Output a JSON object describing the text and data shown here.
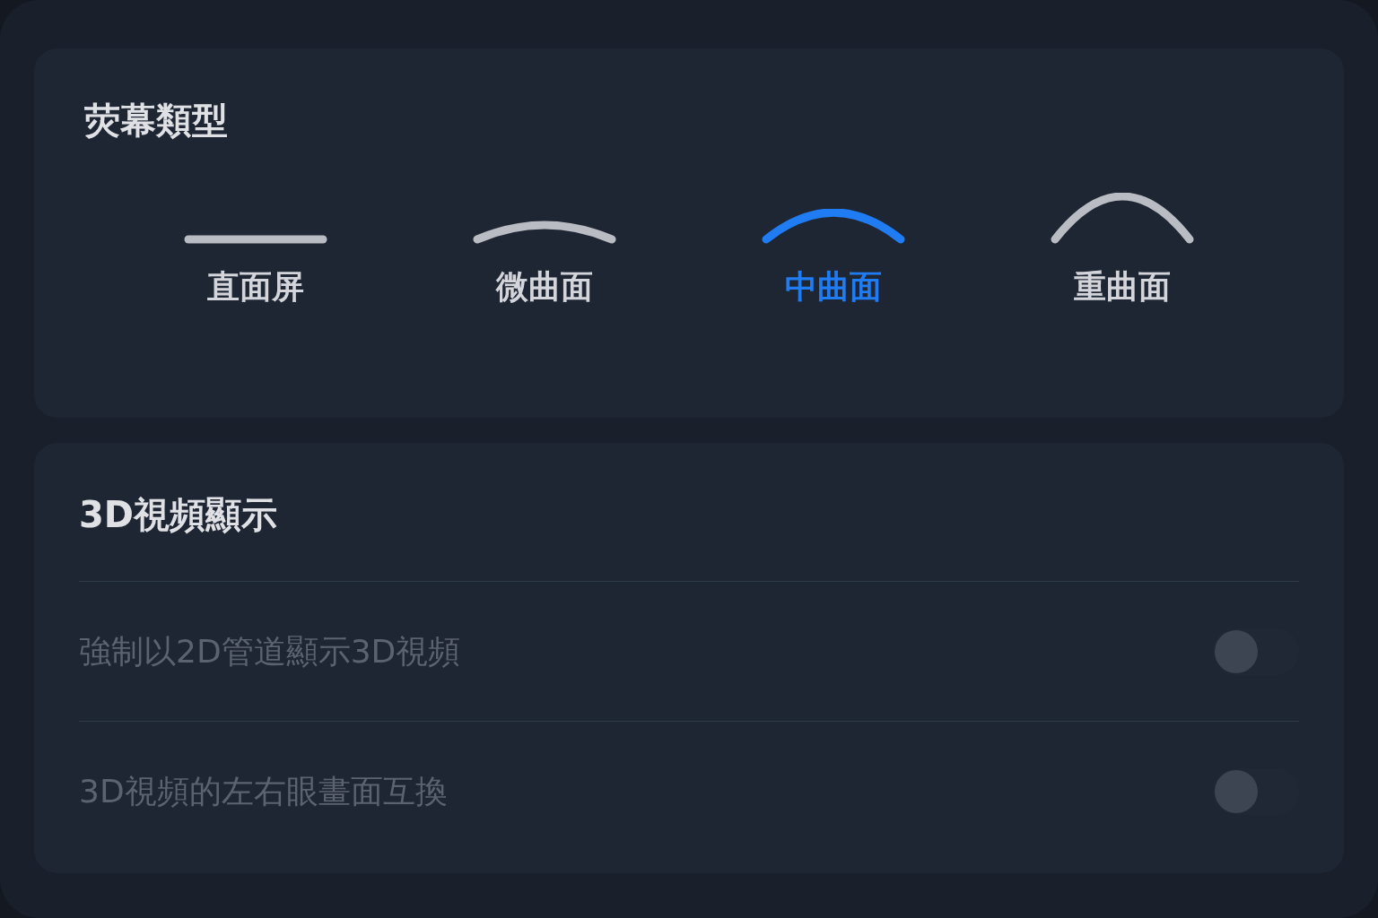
{
  "screen_type": {
    "title": "荧幕類型",
    "options": [
      {
        "label": "直面屏",
        "kind": "flat",
        "selected": false
      },
      {
        "label": "微曲面",
        "kind": "slight",
        "selected": false
      },
      {
        "label": "中曲面",
        "kind": "medium",
        "selected": true
      },
      {
        "label": "重曲面",
        "kind": "heavy",
        "selected": false
      }
    ]
  },
  "video_3d": {
    "title": "3D視頻顯示",
    "settings": [
      {
        "label": "強制以2D管道顯示3D視頻",
        "on": false,
        "disabled": true
      },
      {
        "label": "3D視頻的左右眼畫面互換",
        "on": false,
        "disabled": true
      }
    ]
  }
}
